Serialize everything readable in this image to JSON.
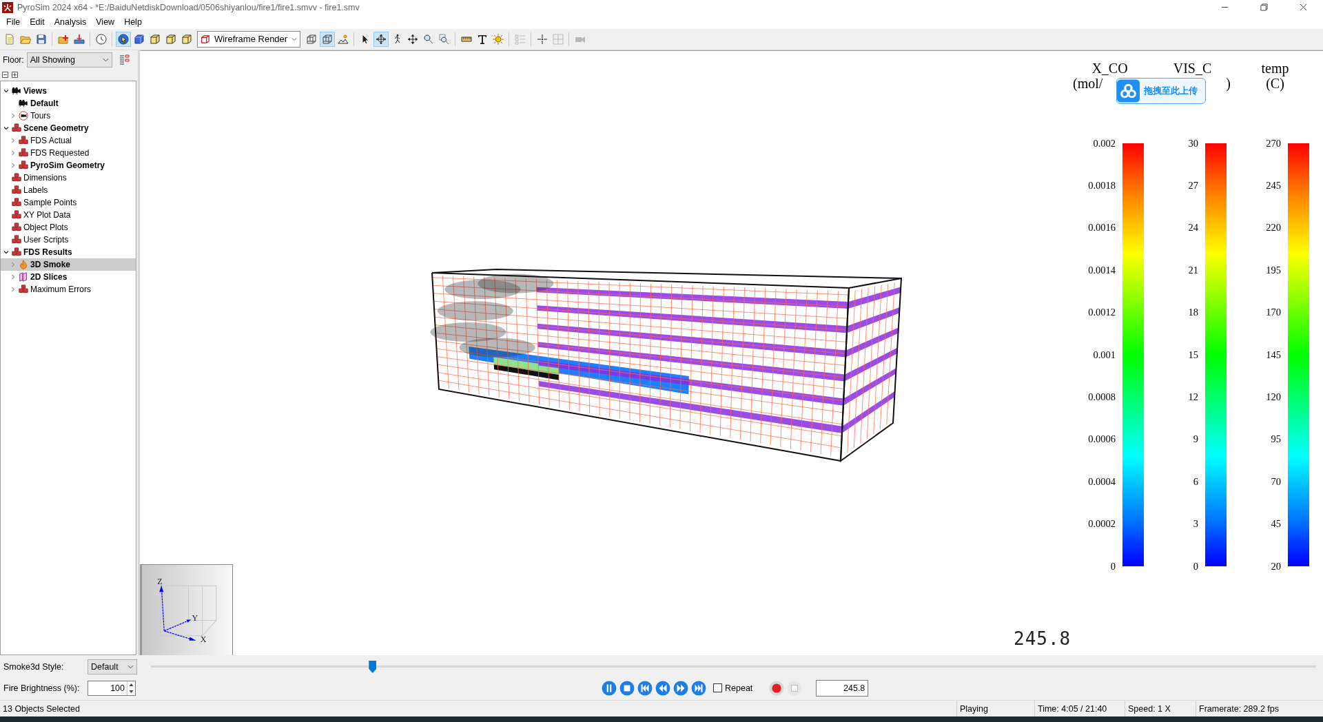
{
  "window": {
    "title": "PyroSim 2024 x64 - *E:/BaiduNetdiskDownload/0506shiyanlou/fire1/fire1.smvv - fire1.smv"
  },
  "menu": [
    "File",
    "Edit",
    "Analysis",
    "View",
    "Help"
  ],
  "toolbar": {
    "items": [
      {
        "kind": "button",
        "selected": false,
        "disabled": false
      },
      {
        "kind": "button",
        "selected": false,
        "disabled": false
      },
      {
        "kind": "button",
        "selected": false,
        "disabled": false
      },
      {
        "kind": "separator"
      },
      {
        "kind": "button",
        "selected": false,
        "disabled": false
      },
      {
        "kind": "button",
        "selected": false,
        "disabled": false
      },
      {
        "kind": "separator"
      },
      {
        "kind": "button",
        "selected": false,
        "disabled": false
      },
      {
        "kind": "separator"
      },
      {
        "kind": "button",
        "selected": true,
        "disabled": false
      },
      {
        "kind": "button",
        "selected": false,
        "disabled": false
      },
      {
        "kind": "button",
        "selected": false,
        "disabled": false
      },
      {
        "kind": "button",
        "selected": false,
        "disabled": false
      },
      {
        "kind": "button",
        "selected": false,
        "disabled": false
      },
      {
        "kind": "combo",
        "value": "Wireframe Render"
      },
      {
        "kind": "button",
        "selected": false,
        "disabled": false
      },
      {
        "kind": "button",
        "selected": true,
        "disabled": false
      },
      {
        "kind": "button",
        "selected": false,
        "disabled": false
      },
      {
        "kind": "separator"
      },
      {
        "kind": "button",
        "selected": false,
        "disabled": false
      },
      {
        "kind": "button",
        "selected": true,
        "disabled": false
      },
      {
        "kind": "button",
        "selected": false,
        "disabled": false
      },
      {
        "kind": "button",
        "selected": false,
        "disabled": false
      },
      {
        "kind": "button",
        "selected": false,
        "disabled": false
      },
      {
        "kind": "button",
        "selected": false,
        "disabled": false
      },
      {
        "kind": "separator"
      },
      {
        "kind": "button",
        "selected": false,
        "disabled": false
      },
      {
        "kind": "button",
        "selected": false,
        "disabled": false
      },
      {
        "kind": "button",
        "selected": false,
        "disabled": false
      },
      {
        "kind": "separator"
      },
      {
        "kind": "button",
        "selected": false,
        "disabled": true
      },
      {
        "kind": "separator"
      },
      {
        "kind": "button",
        "selected": false,
        "disabled": false
      },
      {
        "kind": "button",
        "selected": false,
        "disabled": true
      },
      {
        "kind": "separator"
      },
      {
        "kind": "button",
        "selected": false,
        "disabled": true
      }
    ]
  },
  "floor": {
    "label": "Floor:",
    "value": "All Showing"
  },
  "tree": [
    {
      "label": "Views",
      "kind": "camera",
      "bold": true,
      "selected": false,
      "expandable": true,
      "expanded": true,
      "children": [
        {
          "label": "Default",
          "kind": "camera",
          "bold": true,
          "selected": false,
          "expandable": false
        },
        {
          "label": "Tours",
          "kind": "tour",
          "bold": false,
          "selected": false,
          "expandable": true,
          "expanded": false
        }
      ]
    },
    {
      "label": "Scene Geometry",
      "kind": "geometry",
      "bold": true,
      "selected": false,
      "expandable": true,
      "expanded": true,
      "children": [
        {
          "label": "FDS Actual",
          "kind": "geometry",
          "bold": false,
          "selected": false,
          "expandable": true,
          "expanded": false
        },
        {
          "label": "FDS Requested",
          "kind": "geometry",
          "bold": false,
          "selected": false,
          "expandable": true,
          "expanded": false
        },
        {
          "label": "PyroSim Geometry",
          "kind": "geometry",
          "bold": true,
          "selected": false,
          "expandable": true,
          "expanded": false
        }
      ]
    },
    {
      "label": "Dimensions",
      "kind": "geometry",
      "bold": false,
      "selected": false,
      "expandable": false
    },
    {
      "label": "Labels",
      "kind": "geometry",
      "bold": false,
      "selected": false,
      "expandable": false
    },
    {
      "label": "Sample Points",
      "kind": "geometry",
      "bold": false,
      "selected": false,
      "expandable": false
    },
    {
      "label": "XY Plot Data",
      "kind": "geometry",
      "bold": false,
      "selected": false,
      "expandable": false
    },
    {
      "label": "Object Plots",
      "kind": "geometry",
      "bold": false,
      "selected": false,
      "expandable": false
    },
    {
      "label": "User Scripts",
      "kind": "geometry",
      "bold": false,
      "selected": false,
      "expandable": false
    },
    {
      "label": "FDS Results",
      "kind": "geometry",
      "bold": true,
      "selected": false,
      "expandable": true,
      "expanded": true,
      "children": [
        {
          "label": "3D Smoke",
          "kind": "fire",
          "bold": true,
          "selected": true,
          "expandable": true,
          "expanded": false
        },
        {
          "label": "2D Slices",
          "kind": "slice",
          "bold": true,
          "selected": false,
          "expandable": true,
          "expanded": false
        },
        {
          "label": "Maximum Errors",
          "kind": "geometry",
          "bold": false,
          "selected": false,
          "expandable": true,
          "expanded": false
        }
      ]
    }
  ],
  "legends": [
    {
      "title": "X_CO",
      "subtitle": "(mol/",
      "ticks": [
        "0.002",
        "0.0018",
        "0.0016",
        "0.0014",
        "0.0012",
        "0.001",
        "0.0008",
        "0.0006",
        "0.0004",
        "0.0002",
        "0"
      ]
    },
    {
      "title": "VIS_C",
      "subtitle": ")",
      "ticks": [
        "30",
        "27",
        "24",
        "21",
        "18",
        "15",
        "12",
        "9",
        "6",
        "3",
        "0"
      ]
    },
    {
      "title": "temp",
      "subtitle": "(C)",
      "ticks": [
        "270",
        "245",
        "220",
        "195",
        "170",
        "145",
        "120",
        "95",
        "70",
        "45",
        "20"
      ]
    }
  ],
  "upload_overlay": {
    "text": "拖拽至此上传"
  },
  "time_display": "245.8",
  "axes": {
    "z": "Z",
    "y": "Y",
    "x": "X"
  },
  "controls": {
    "smoke_style": {
      "label": "Smoke3d Style:",
      "value": "Default"
    },
    "timeline": {
      "level": 0.19
    },
    "fire_brightness": {
      "label": "Fire Brightness (%):",
      "value": "100"
    },
    "repeat": {
      "label": "Repeat",
      "checked": false
    },
    "time_field": "245.8"
  },
  "status_bar": [
    "13 Objects Selected",
    "Playing",
    "Time: 4:05 / 21:40",
    "Speed: 1 X",
    "Framerate: 289.2 fps"
  ]
}
